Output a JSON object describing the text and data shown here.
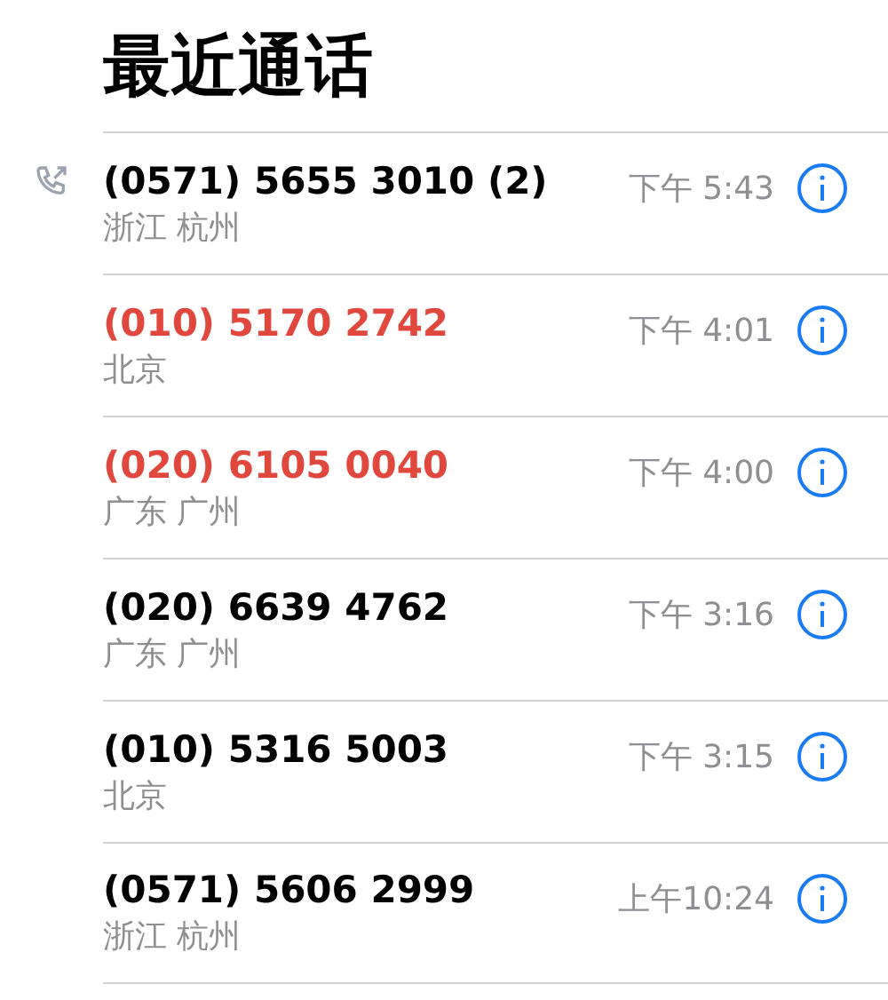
{
  "title": "最近通话",
  "calls": [
    {
      "number": "(0571) 5655 3010 (2)",
      "location": "浙江 杭州",
      "time": "下午 5:43",
      "missed": false,
      "outgoing": true
    },
    {
      "number": "(010) 5170 2742",
      "location": "北京",
      "time": "下午 4:01",
      "missed": true,
      "outgoing": false
    },
    {
      "number": "(020) 6105 0040",
      "location": "广东 广州",
      "time": "下午 4:00",
      "missed": true,
      "outgoing": false
    },
    {
      "number": "(020) 6639 4762",
      "location": "广东 广州",
      "time": "下午 3:16",
      "missed": false,
      "outgoing": false
    },
    {
      "number": "(010) 5316 5003",
      "location": "北京",
      "time": "下午 3:15",
      "missed": false,
      "outgoing": false
    },
    {
      "number": "(0571) 5606 2999",
      "location": "浙江 杭州",
      "time": "上午10:24",
      "missed": false,
      "outgoing": false
    }
  ]
}
